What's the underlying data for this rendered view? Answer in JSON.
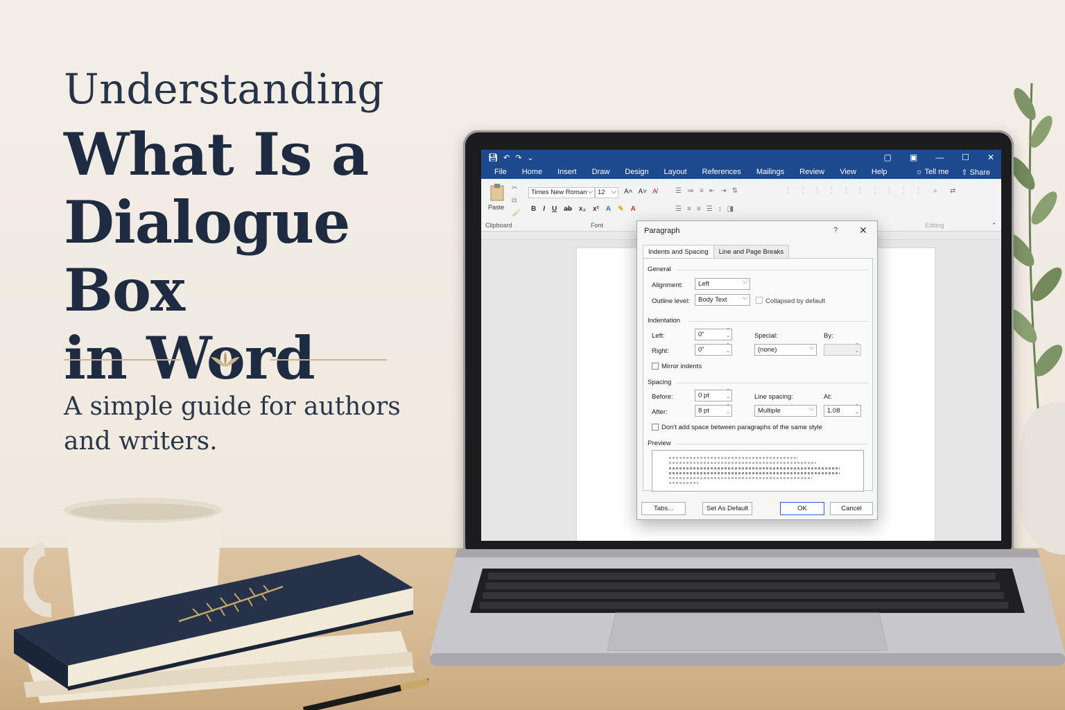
{
  "hero": {
    "kicker": "Understanding",
    "title_line1": "What Is a",
    "title_line2": "Dialogue Box",
    "title_line3": "in Word",
    "subtitle_line1": "A simple guide for authors",
    "subtitle_line2": "and writers."
  },
  "word": {
    "menu": [
      "File",
      "Home",
      "Insert",
      "Draw",
      "Design",
      "Layout",
      "References",
      "Mailings",
      "Review",
      "View",
      "Help"
    ],
    "tell_me": "Tell me",
    "share": "Share",
    "ribbon": {
      "paste_label": "Paste",
      "clipboard_label": "Clipboard",
      "font_name": "Times New Roman",
      "font_size": "12",
      "font_group_label": "Font",
      "editing_label": "Editing"
    }
  },
  "dialog": {
    "title": "Paragraph",
    "help": "?",
    "close": "✕",
    "tabs": [
      "Indents and Spacing",
      "Line and Page Breaks"
    ],
    "general": {
      "heading": "General",
      "alignment_label": "Alignment:",
      "alignment_value": "Left",
      "outline_label": "Outline level:",
      "outline_value": "Body Text",
      "collapsed_label": "Collapsed by default"
    },
    "indentation": {
      "heading": "Indentation",
      "left_label": "Left:",
      "left_value": "0\"",
      "right_label": "Right:",
      "right_value": "0\"",
      "special_label": "Special:",
      "special_value": "(none)",
      "by_label": "By:",
      "mirror_label": "Mirror indents"
    },
    "spacing": {
      "heading": "Spacing",
      "before_label": "Before:",
      "before_value": "0 pt",
      "after_label": "After:",
      "after_value": "8 pt",
      "line_spacing_label": "Line spacing:",
      "line_spacing_value": "Multiple",
      "at_label": "At:",
      "at_value": "1.08",
      "dont_add_label": "Don't add space between paragraphs of the same style"
    },
    "preview_heading": "Preview",
    "buttons": {
      "tabs": "Tabs...",
      "set_default": "Set As Default",
      "ok": "OK",
      "cancel": "Cancel"
    }
  },
  "colors": {
    "word_blue": "#1d4a8f",
    "title_navy": "#1f2b40",
    "accent_gold": "#c9b48e"
  }
}
